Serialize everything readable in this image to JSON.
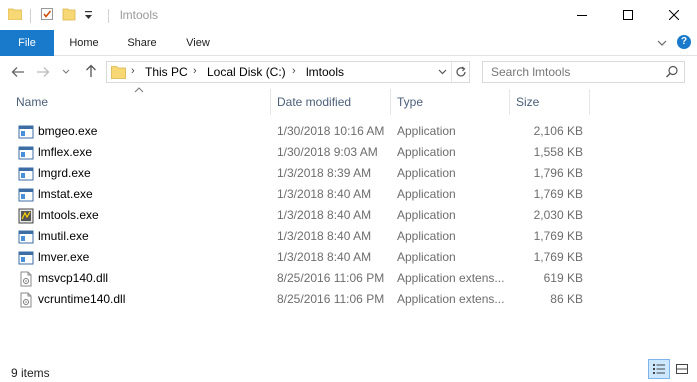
{
  "window": {
    "title": "lmtools"
  },
  "ribbon": {
    "tabs": [
      "File",
      "Home",
      "Share",
      "View"
    ],
    "help_label": "?"
  },
  "address": {
    "crumbs": [
      "This PC",
      "Local Disk (C:)",
      "lmtools"
    ]
  },
  "search": {
    "placeholder": "Search lmtools"
  },
  "columns": {
    "name": "Name",
    "date": "Date modified",
    "type": "Type",
    "size": "Size"
  },
  "files": [
    {
      "name": "bmgeo.exe",
      "date": "1/30/2018 10:16 AM",
      "type": "Application",
      "size": "2,106 KB",
      "icon": "application-icon"
    },
    {
      "name": "lmflex.exe",
      "date": "1/30/2018 9:03 AM",
      "type": "Application",
      "size": "1,558 KB",
      "icon": "application-icon"
    },
    {
      "name": "lmgrd.exe",
      "date": "1/3/2018 8:39 AM",
      "type": "Application",
      "size": "1,796 KB",
      "icon": "application-icon"
    },
    {
      "name": "lmstat.exe",
      "date": "1/3/2018 8:40 AM",
      "type": "Application",
      "size": "1,769 KB",
      "icon": "application-icon"
    },
    {
      "name": "lmtools.exe",
      "date": "1/3/2018 8:40 AM",
      "type": "Application",
      "size": "2,030 KB",
      "icon": "lmtools-app-icon"
    },
    {
      "name": "lmutil.exe",
      "date": "1/3/2018 8:40 AM",
      "type": "Application",
      "size": "1,769 KB",
      "icon": "application-icon"
    },
    {
      "name": "lmver.exe",
      "date": "1/3/2018 8:40 AM",
      "type": "Application",
      "size": "1,769 KB",
      "icon": "application-icon"
    },
    {
      "name": "msvcp140.dll",
      "date": "8/25/2016 11:06 PM",
      "type": "Application extens...",
      "size": "619 KB",
      "icon": "dll-file-icon"
    },
    {
      "name": "vcruntime140.dll",
      "date": "8/25/2016 11:06 PM",
      "type": "Application extens...",
      "size": "86 KB",
      "icon": "dll-file-icon"
    }
  ],
  "status": {
    "item_count": "9 items"
  },
  "colors": {
    "accent": "#1979ca",
    "header_text": "#4c607a",
    "folder_yellow": "#f8d775",
    "detail_text": "#6d6d6d"
  }
}
